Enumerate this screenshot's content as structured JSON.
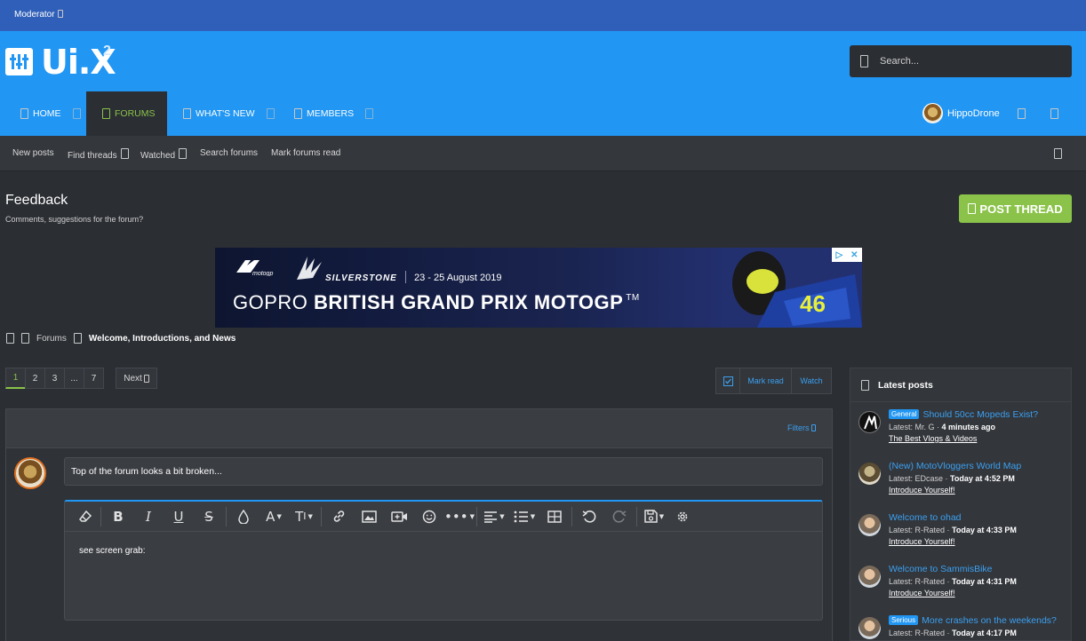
{
  "modbar": {
    "label": "Moderator"
  },
  "header": {
    "logo_text": "Ui.X",
    "logo_sup": "2",
    "search_placeholder": "Search..."
  },
  "nav": {
    "tabs": [
      {
        "label": "HOME",
        "active": false
      },
      {
        "label": "FORUMS",
        "active": true
      },
      {
        "label": "WHAT'S NEW",
        "active": false
      },
      {
        "label": "MEMBERS",
        "active": false
      }
    ],
    "username": "HippoDrone"
  },
  "subnav": {
    "links": [
      "New posts",
      "Find threads",
      "Watched",
      "Search forums",
      "Mark forums read"
    ]
  },
  "page": {
    "title": "Feedback",
    "description": "Comments, suggestions for the forum?",
    "post_thread_label": "POST THREAD"
  },
  "banner": {
    "brand": "motogp",
    "venue": "SILVERSTONE",
    "dates": "23 - 25 August 2019",
    "headline_prefix": "GOPRO",
    "headline_main": "BRITISH GRAND PRIX MOTOGP",
    "trademark": "TM",
    "rider_number": "46"
  },
  "breadcrumb": {
    "items": [
      "Forums",
      "Welcome, Introductions, and News"
    ]
  },
  "pagination": {
    "pages": [
      "1",
      "2",
      "3",
      "...",
      "7"
    ],
    "current": "1",
    "next_label": "Next"
  },
  "thread_tools": {
    "mark_read": "Mark read",
    "watch": "Watch"
  },
  "filters_label": "Filters",
  "composer": {
    "thread_title_value": "Top of the forum looks a bit broken...",
    "body": "see screen grab:"
  },
  "sidebar": {
    "title": "Latest posts",
    "posts": [
      {
        "prefix": "General",
        "title": "Should 50cc Mopeds Exist?",
        "latest_label": "Latest: Mr. G ·",
        "time": "4 minutes ago",
        "forum": "The Best Vlogs & Videos"
      },
      {
        "prefix": "",
        "title": "(New) MotoVloggers World Map",
        "latest_label": "Latest: EDcase ·",
        "time": "Today at 4:52 PM",
        "forum": "Introduce Yourself!"
      },
      {
        "prefix": "",
        "title": "Welcome to ohad",
        "latest_label": "Latest: R-Rated ·",
        "time": "Today at 4:33 PM",
        "forum": "Introduce Yourself!"
      },
      {
        "prefix": "",
        "title": "Welcome to SammisBike",
        "latest_label": "Latest: R-Rated ·",
        "time": "Today at 4:31 PM",
        "forum": "Introduce Yourself!"
      },
      {
        "prefix": "Serious",
        "title": "More crashes on the weekends?",
        "latest_label": "Latest: R-Rated ·",
        "time": "Today at 4:17 PM",
        "forum": ""
      }
    ]
  },
  "colors": {
    "accent": "#2196f3",
    "modbar": "#2f5fb8",
    "active": "#8bc34a",
    "background": "#2b2e33"
  }
}
